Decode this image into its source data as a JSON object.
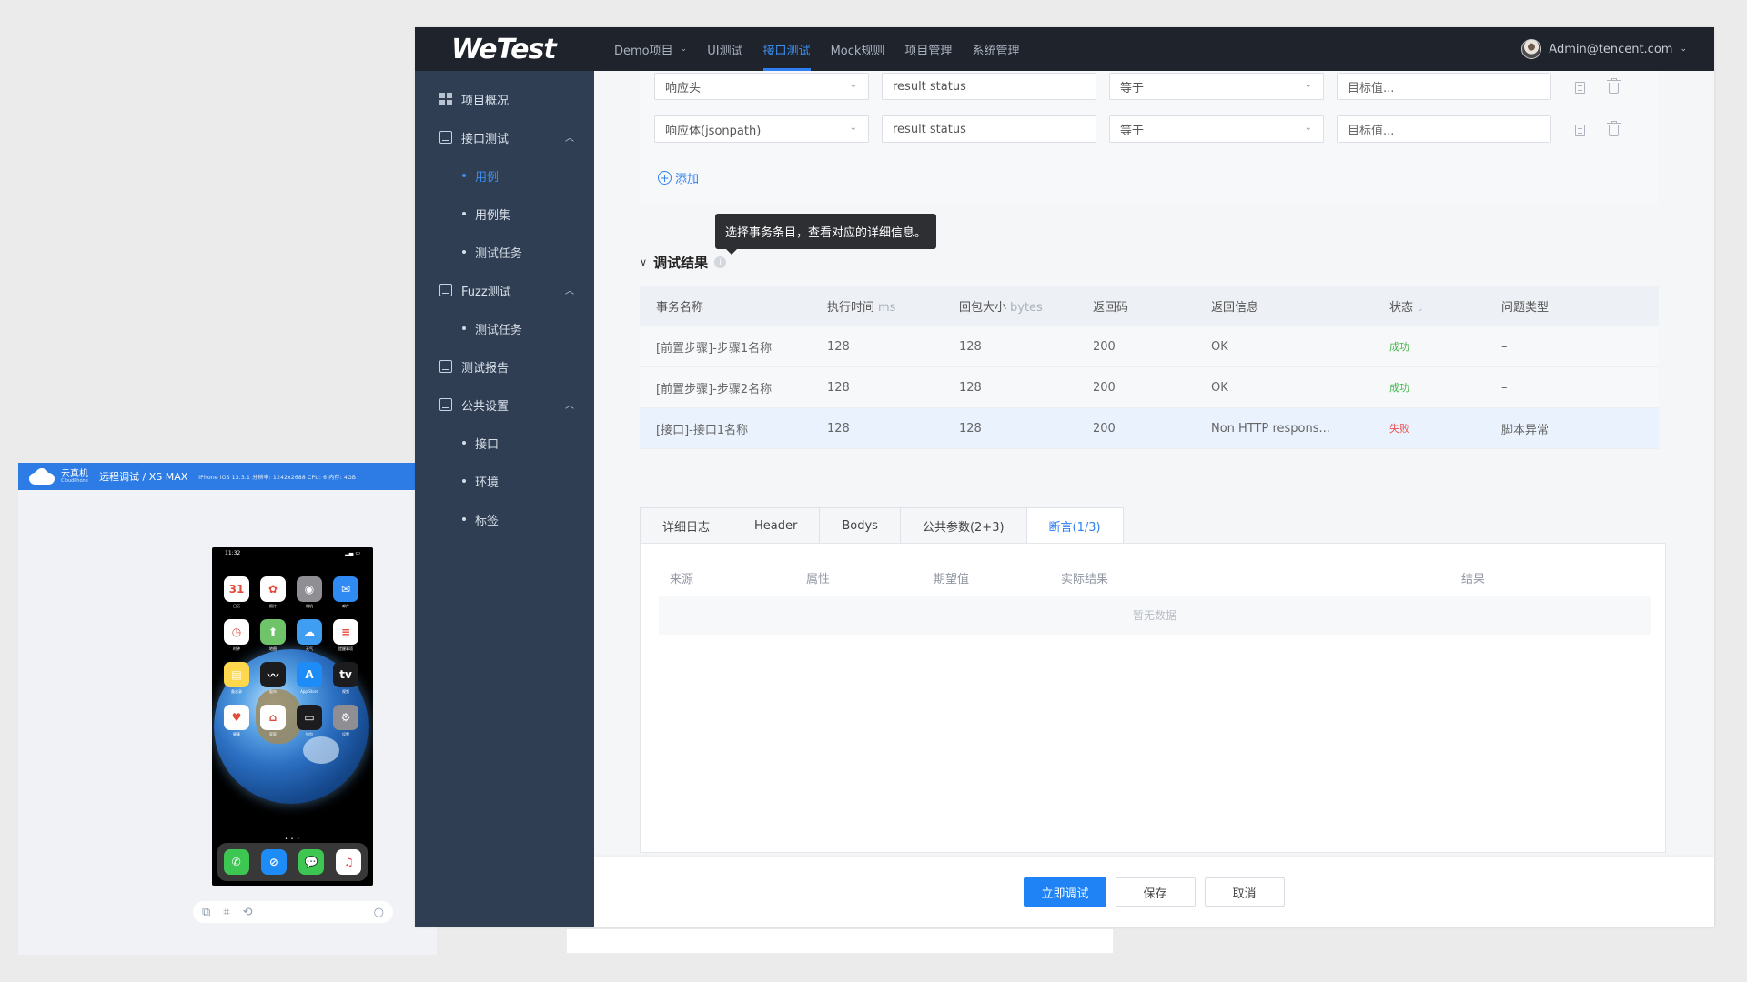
{
  "emulator": {
    "brand_cn": "云真机",
    "brand_en": "CloudPhone",
    "title": "远程调试 / XS MAX",
    "specs": "iPhone   iOS 13.3.1   分辨率: 1242x2688   CPU: 6   内存: 4GB",
    "phone_time": "11:32",
    "calendar_day": "31",
    "apps": [
      {
        "label": "日历",
        "color": "#ffffff",
        "glyph": "31"
      },
      {
        "label": "照片",
        "color": "#ffffff",
        "glyph": "✿"
      },
      {
        "label": "相机",
        "color": "#8e8e93",
        "glyph": "◉"
      },
      {
        "label": "邮件",
        "color": "#2f8bf3",
        "glyph": "✉"
      },
      {
        "label": "时钟",
        "color": "#ffffff",
        "glyph": "◷"
      },
      {
        "label": "地图",
        "color": "#6fc46a",
        "glyph": "⬆"
      },
      {
        "label": "天气",
        "color": "#3f9ef2",
        "glyph": "☁"
      },
      {
        "label": "提醒事项",
        "color": "#ffffff",
        "glyph": "≡"
      },
      {
        "label": "备忘录",
        "color": "#ffd84d",
        "glyph": "▤"
      },
      {
        "label": "股市",
        "color": "#1c1c1e",
        "glyph": "〰"
      },
      {
        "label": "App Store",
        "color": "#1e8cf7",
        "glyph": "A"
      },
      {
        "label": "视频",
        "color": "#1c1c1e",
        "glyph": "tv"
      },
      {
        "label": "健康",
        "color": "#ffffff",
        "glyph": "♥"
      },
      {
        "label": "家庭",
        "color": "#ffffff",
        "glyph": "⌂"
      },
      {
        "label": "钱包",
        "color": "#1c1c1e",
        "glyph": "▭"
      },
      {
        "label": "设置",
        "color": "#8e8e93",
        "glyph": "⚙"
      }
    ],
    "dock": [
      {
        "label": "电话",
        "color": "#3ec653",
        "glyph": "✆"
      },
      {
        "label": "Safari",
        "color": "#1e8cf7",
        "glyph": "⊘"
      },
      {
        "label": "信息",
        "color": "#3ec653",
        "glyph": "💬"
      },
      {
        "label": "音乐",
        "color": "#ffffff",
        "glyph": "♫"
      }
    ]
  },
  "topbar": {
    "logo": "WeTest",
    "nav": [
      {
        "label": "Demo项目",
        "has_dropdown": true
      },
      {
        "label": "UI测试"
      },
      {
        "label": "接口测试",
        "active": true
      },
      {
        "label": "Mock规则"
      },
      {
        "label": "项目管理"
      },
      {
        "label": "系统管理"
      }
    ],
    "user": "Admin@tencent.com"
  },
  "sidebar": {
    "overview": "项目概况",
    "api_test": "接口测试",
    "api_items": [
      "用例",
      "用例集",
      "测试任务"
    ],
    "fuzz": "Fuzz测试",
    "fuzz_items": [
      "测试任务"
    ],
    "report": "测试报告",
    "public": "公共设置",
    "public_items": [
      "接口",
      "环境",
      "标签"
    ]
  },
  "assertions": {
    "rows": [
      {
        "source": "响应头",
        "field": "result status",
        "op": "等于",
        "target_placeholder": "目标值..."
      },
      {
        "source": "响应体(jsonpath)",
        "field": "result status",
        "op": "等于",
        "target_placeholder": "目标值..."
      }
    ],
    "add_label": "添加"
  },
  "tooltip": "选择事务条目，查看对应的详细信息。",
  "debug": {
    "title": "调试结果",
    "columns": {
      "name": "事务名称",
      "time": "执行时间",
      "time_unit": "ms",
      "size": "回包大小",
      "size_unit": "bytes",
      "code": "返回码",
      "msg": "返回信息",
      "status": "状态",
      "issue": "问题类型"
    },
    "rows": [
      {
        "name": "[前置步骤]-步骤1名称",
        "time": "128",
        "size": "128",
        "code": "200",
        "msg": "OK",
        "status": "成功",
        "issue": "–"
      },
      {
        "name": "[前置步骤]-步骤2名称",
        "time": "128",
        "size": "128",
        "code": "200",
        "msg": "OK",
        "status": "成功",
        "issue": "–"
      },
      {
        "name": "[接口]-接口1名称",
        "time": "128",
        "size": "128",
        "code": "200",
        "msg": "Non HTTP respons...",
        "status": "失败",
        "issue": "脚本异常"
      }
    ]
  },
  "detail_tabs": [
    "详细日志",
    "Header",
    "Bodys",
    "公共参数(2+3)",
    "断言(1/3)"
  ],
  "assert_table": {
    "columns": [
      "来源",
      "属性",
      "期望值",
      "实际结果",
      "结果"
    ],
    "empty": "暂无数据"
  },
  "footer": {
    "run": "立即调试",
    "save": "保存",
    "cancel": "取消"
  },
  "colors": {
    "topbar": "#1e232c",
    "sidebar": "#2f3e52",
    "primary": "#1f83f5",
    "success": "#44b549",
    "fail": "#ef4b4b"
  }
}
